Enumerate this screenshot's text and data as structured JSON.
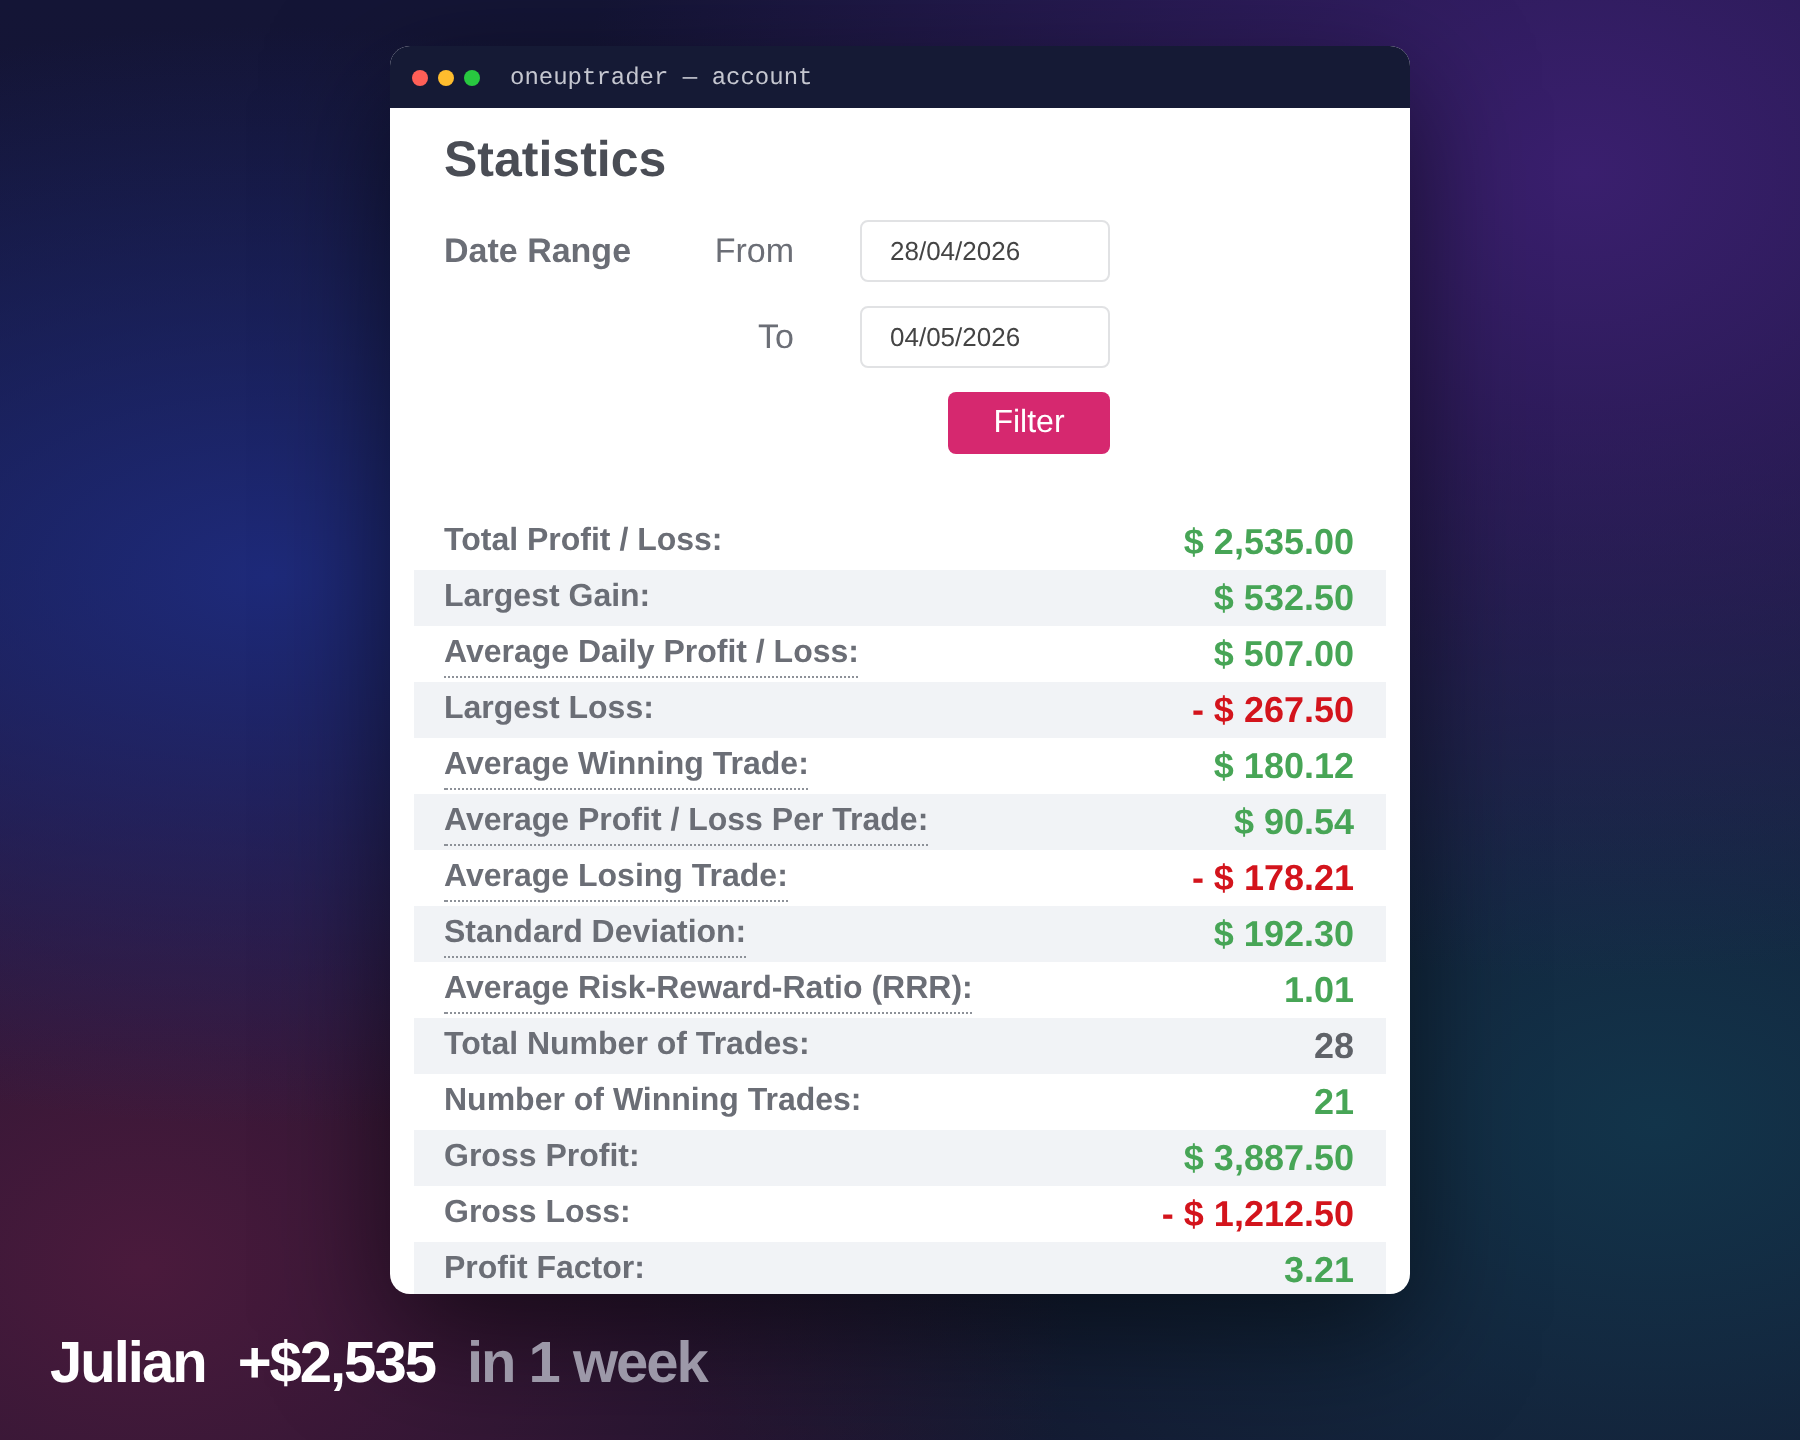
{
  "window": {
    "title": "oneuptrader — account"
  },
  "page": {
    "heading": "Statistics",
    "date_range": {
      "label": "Date Range",
      "from": {
        "label": "From",
        "value": "28/04/2026"
      },
      "to": {
        "label": "To",
        "value": "04/05/2026"
      },
      "button": "Filter"
    },
    "stats": [
      {
        "label": "Total Profit / Loss:",
        "value": "$ 2,535.00",
        "color": "#47a556",
        "dotted_underline": false
      },
      {
        "label": "Largest Gain:",
        "value": "$ 532.50",
        "color": "#47a556",
        "dotted_underline": false
      },
      {
        "label": "Average Daily Profit / Loss:",
        "value": "$ 507.00",
        "color": "#47a556",
        "dotted_underline": true
      },
      {
        "label": "Largest Loss:",
        "value": "- $ 267.50",
        "color": "#d3141c",
        "dotted_underline": false
      },
      {
        "label": "Average Winning Trade:",
        "value": "$ 180.12",
        "color": "#47a556",
        "dotted_underline": true
      },
      {
        "label": "Average Profit / Loss Per Trade:",
        "value": "$ 90.54",
        "color": "#47a556",
        "dotted_underline": true
      },
      {
        "label": "Average Losing Trade:",
        "value": "- $ 178.21",
        "color": "#d3141c",
        "dotted_underline": true
      },
      {
        "label": "Standard Deviation:",
        "value": "$ 192.30",
        "color": "#47a556",
        "dotted_underline": true
      },
      {
        "label": "Average Risk-Reward-Ratio (RRR):",
        "value": "1.01",
        "color": "#47a556",
        "dotted_underline": true
      },
      {
        "label": "Total Number of Trades:",
        "value": "28",
        "color": "#5f6268",
        "dotted_underline": false
      },
      {
        "label": "Number of Winning Trades:",
        "value": "21",
        "color": "#47a556",
        "dotted_underline": false
      },
      {
        "label": "Gross Profit:",
        "value": "$ 3,887.50",
        "color": "#47a556",
        "dotted_underline": false
      },
      {
        "label": "Gross Loss:",
        "value": "- $ 1,212.50",
        "color": "#d3141c",
        "dotted_underline": false
      },
      {
        "label": "Profit Factor:",
        "value": "3.21",
        "color": "#47a556",
        "dotted_underline": false
      }
    ]
  },
  "caption": {
    "name": "Julian",
    "gain": "+$2,535",
    "period": "in 1 week"
  }
}
